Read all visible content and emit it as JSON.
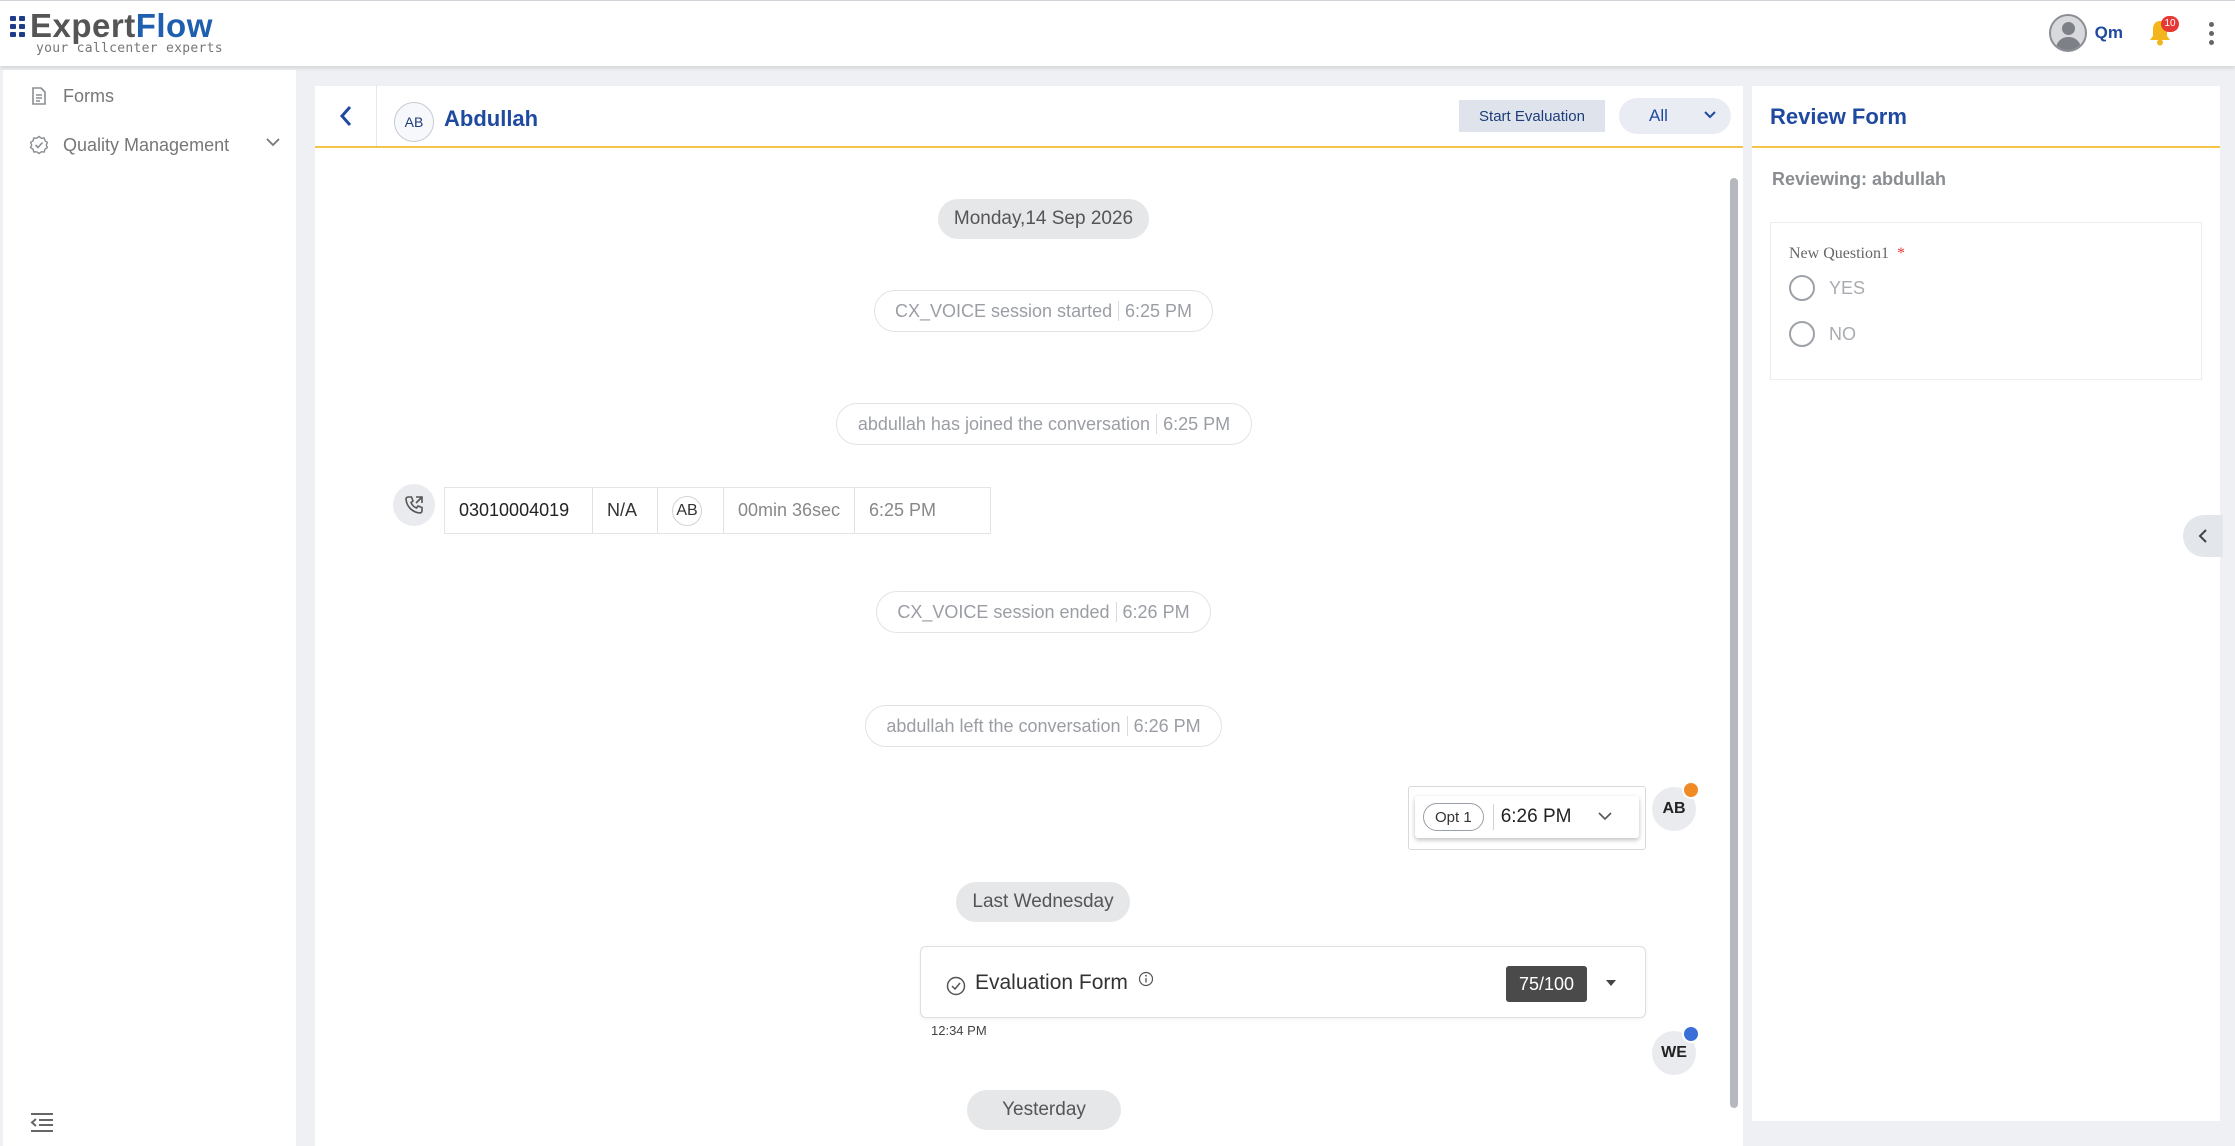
{
  "header": {
    "logo_expert": "Expert",
    "logo_flow": "Flow",
    "logo_tagline": "your callcenter experts",
    "user_name": "Qm",
    "notification_count": "10"
  },
  "sidebar": {
    "items": [
      {
        "label": "Forms",
        "icon": "forms-icon"
      },
      {
        "label": "Quality Management",
        "icon": "quality-icon",
        "expandable": true
      }
    ]
  },
  "conversation": {
    "contact_initials": "AB",
    "contact_name": "Abdullah",
    "start_evaluation_label": "Start Evaluation",
    "filter_value": "All",
    "messages": {
      "date1": "Monday,14 Sep 2026",
      "sys1_text": "CX_VOICE session started",
      "sys1_time": "6:25 PM",
      "sys2_text": "abdullah has joined the conversation",
      "sys2_time": "6:25 PM",
      "call": {
        "number": "03010004019",
        "status": "N/A",
        "agent_initials": "AB",
        "duration": "00min 36sec",
        "time": "6:25 PM"
      },
      "sys3_text": "CX_VOICE session ended",
      "sys3_time": "6:26 PM",
      "sys4_text": "abdullah left the conversation",
      "sys4_time": "6:26 PM",
      "option_message": {
        "option": "Opt 1",
        "time": "6:26 PM",
        "sender_initials": "AB"
      },
      "date2": "Last Wednesday",
      "evaluation": {
        "title": "Evaluation Form",
        "score": "75/100",
        "time": "12:34 PM",
        "sender_initials": "WE"
      },
      "date3": "Yesterday"
    }
  },
  "review_form": {
    "title": "Review Form",
    "reviewing": "Reviewing: abdullah",
    "question_label": "New Question1",
    "required_mark": "*",
    "options": [
      "YES",
      "NO"
    ]
  },
  "colors": {
    "brand_blue": "#1f4aa0",
    "accent_yellow": "#f5c54a",
    "badge_red": "#e53935",
    "badge_orange": "#f08a24"
  }
}
